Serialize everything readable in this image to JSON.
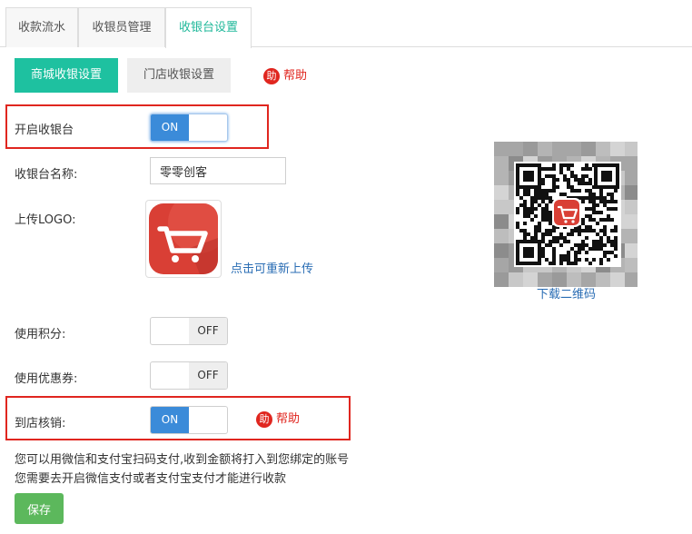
{
  "top_tabs": [
    "收款流水",
    "收银员管理",
    "收银台设置"
  ],
  "sub_tabs": [
    "商城收银设置",
    "门店收银设置"
  ],
  "help": {
    "badge": "助",
    "label": "帮助"
  },
  "form": {
    "enable_cashier": {
      "label": "开启收银台",
      "state": "ON"
    },
    "cashier_name": {
      "label": "收银台名称:",
      "value": "零零创客"
    },
    "upload_logo": {
      "label": "上传LOGO:",
      "reupload_link": "点击可重新上传"
    },
    "use_points": {
      "label": "使用积分:",
      "state": "OFF"
    },
    "use_coupons": {
      "label": "使用优惠券:",
      "state": "OFF"
    },
    "instore_verify": {
      "label": "到店核销:",
      "state": "ON"
    }
  },
  "notes": [
    "您可以用微信和支付宝扫码支付,收到金额将打入到您绑定的账号",
    "您需要去开启微信支付或者支付宝支付才能进行收款"
  ],
  "save_label": "保存",
  "qr": {
    "download_label": "下载二维码"
  },
  "colors": {
    "accent": "#1ec1a0",
    "toggle_on": "#3b8bd9",
    "help_red": "#e0261f",
    "save_green": "#5cb85c",
    "link": "#2a6db4"
  },
  "icons": {
    "logo": "shopping-cart-icon",
    "help": "help-badge-icon"
  }
}
